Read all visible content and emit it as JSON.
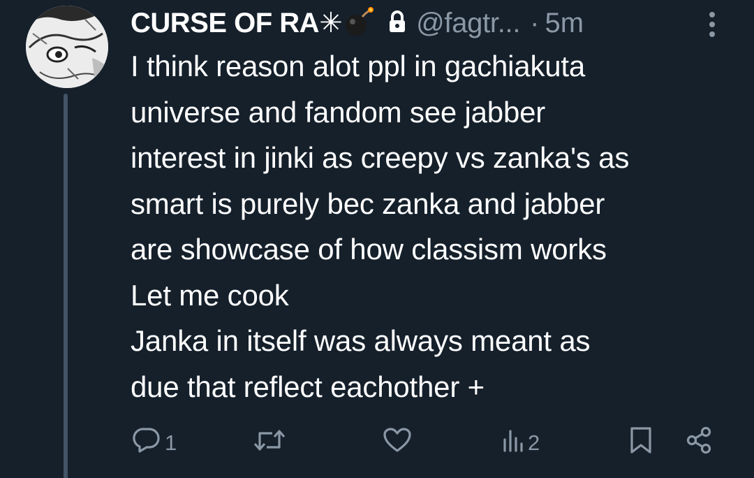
{
  "tweet": {
    "display_name": "CURSE OF RA✳",
    "handle": "@fagtr...",
    "separator": "·",
    "time": "5m",
    "body_lines": [
      "I think reason alot ppl in gachiakuta",
      "universe and fandom see jabber",
      "interest in jinki as creepy vs zanka's as",
      "smart is purely bec zanka and jabber",
      "are showcase of how classism works",
      "Let me cook",
      "Janka in itself was always meant as",
      "due that reflect eachother +"
    ]
  },
  "actions": {
    "reply_count": "1",
    "retweet_count": "",
    "like_count": "",
    "views_count": "2"
  },
  "icons": {
    "avatar": "avatar-manga-drawing",
    "name_emoji": "bomb-icon",
    "protected": "lock-icon",
    "more": "more-vertical-icon",
    "reply": "reply-icon",
    "retweet": "retweet-icon",
    "like": "heart-icon",
    "views": "views-chart-icon",
    "bookmark": "bookmark-icon",
    "share": "share-icon"
  },
  "colors": {
    "background": "#15202b",
    "primary_text": "#ffffff",
    "secondary_text": "#8b98a5",
    "thread_line": "#425466"
  }
}
